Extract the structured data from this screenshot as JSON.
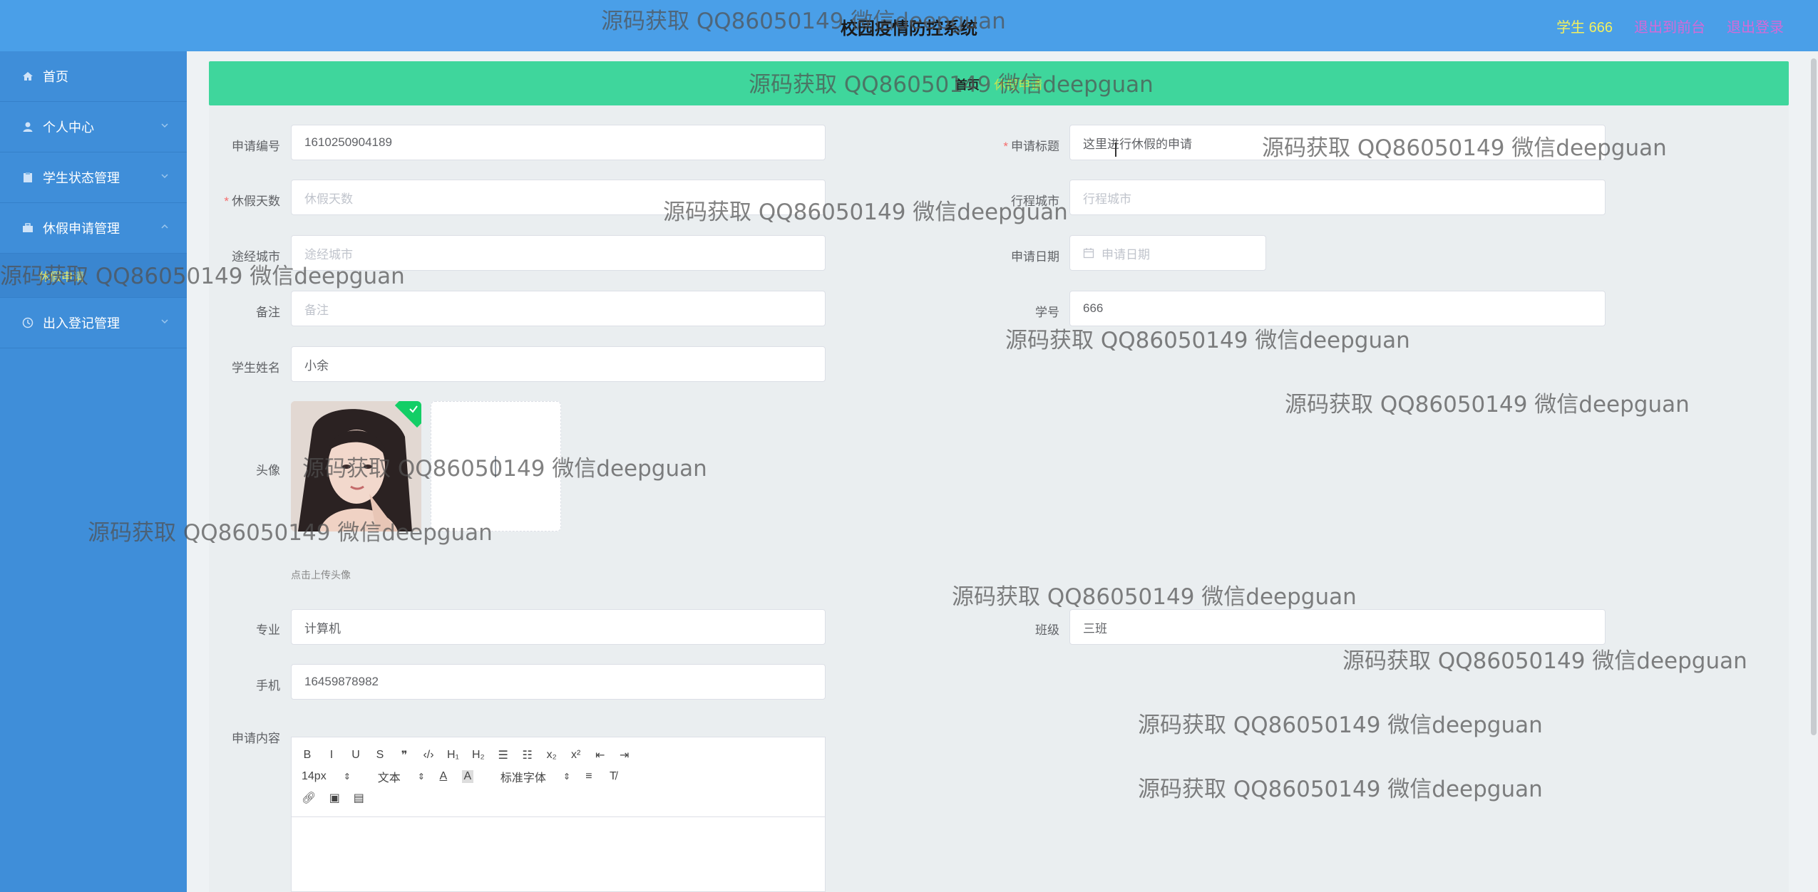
{
  "header": {
    "title": "校园疫情防控系统",
    "user_label": "学生 666",
    "back_label": "退出到前台",
    "logout_label": "退出登录"
  },
  "sidebar": {
    "items": [
      {
        "label": "首页",
        "icon": "home-icon"
      },
      {
        "label": "个人中心",
        "icon": "user-icon"
      },
      {
        "label": "学生状态管理",
        "icon": "clipboard-icon"
      },
      {
        "label": "休假申请管理",
        "icon": "briefcase-icon"
      },
      {
        "label": "出入登记管理",
        "icon": "clock-icon"
      }
    ],
    "submenu": {
      "label": "休假申请"
    }
  },
  "breadcrumb": {
    "home": "首页",
    "separator": "/",
    "current": "休假申请"
  },
  "form": {
    "apply_no": {
      "label": "申请编号",
      "value": "1610250904189"
    },
    "apply_title": {
      "label": "申请标题",
      "value": "这里进行休假的申请"
    },
    "days": {
      "label": "休假天数",
      "placeholder": "休假天数"
    },
    "city": {
      "label": "行程城市",
      "placeholder": "行程城市"
    },
    "via_city": {
      "label": "途经城市",
      "placeholder": "途经城市"
    },
    "apply_date": {
      "label": "申请日期",
      "placeholder": "申请日期"
    },
    "remark": {
      "label": "备注",
      "placeholder": "备注"
    },
    "student_no": {
      "label": "学号",
      "value": "666"
    },
    "student_name": {
      "label": "学生姓名",
      "value": "小余"
    },
    "avatar": {
      "label": "头像",
      "hint": "点击上传头像"
    },
    "major": {
      "label": "专业",
      "value": "计算机"
    },
    "class": {
      "label": "班级",
      "value": "三班"
    },
    "phone": {
      "label": "手机",
      "value": "16459878982"
    },
    "content": {
      "label": "申请内容"
    }
  },
  "editor": {
    "row1": [
      "B",
      "I",
      "U",
      "S",
      "❞",
      "‹/›",
      "H₁",
      "H₂",
      "☰",
      "☷",
      "x₂",
      "x²",
      "⇤",
      "⇥"
    ],
    "font_size": "14px",
    "text_type": "文本",
    "font_family": "标准字体"
  },
  "watermark": "源码获取 QQ86050149 微信deepguan"
}
